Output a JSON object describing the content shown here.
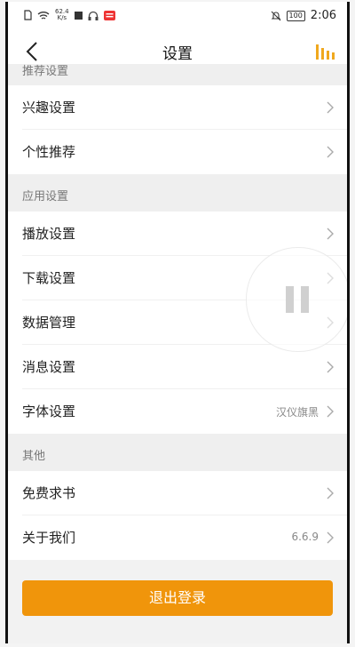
{
  "status_bar": {
    "speed_value": "62.4",
    "speed_unit": "K/s",
    "battery": "100",
    "time": "2:06"
  },
  "header": {
    "title": "设置"
  },
  "sections": [
    {
      "title": "推荐设置",
      "items": [
        {
          "label": "兴趣设置",
          "value": ""
        },
        {
          "label": "个性推荐",
          "value": ""
        }
      ]
    },
    {
      "title": "应用设置",
      "items": [
        {
          "label": "播放设置",
          "value": ""
        },
        {
          "label": "下载设置",
          "value": ""
        },
        {
          "label": "数据管理",
          "value": ""
        },
        {
          "label": "消息设置",
          "value": ""
        },
        {
          "label": "字体设置",
          "value": "汉仪旗黑"
        }
      ]
    },
    {
      "title": "其他",
      "items": [
        {
          "label": "免费求书",
          "value": ""
        },
        {
          "label": "关于我们",
          "value": "6.6.9"
        }
      ]
    }
  ],
  "logout": {
    "label": "退出登录"
  },
  "colors": {
    "accent": "#f0950b",
    "section_bg": "#efefef"
  }
}
